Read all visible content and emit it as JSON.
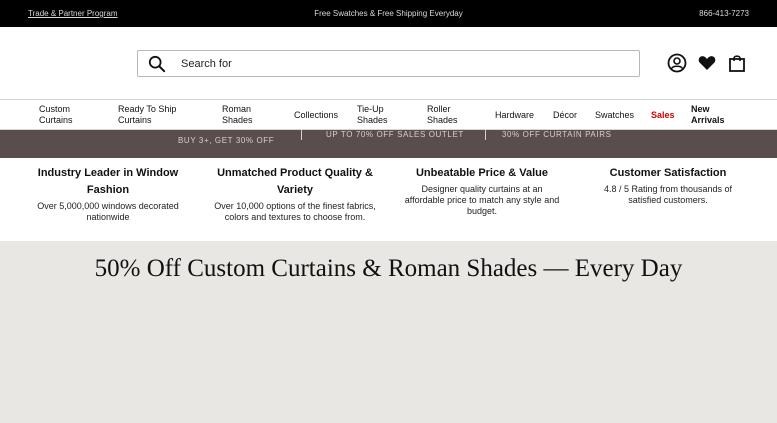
{
  "topbar": {
    "trade_link": "Trade & Partner Program",
    "announcement": "Free Swatches & Free Shipping Everyday",
    "phone": "866-413-7273"
  },
  "header": {
    "search_placeholder": "Search for",
    "icons": [
      "search-icon",
      "account-icon",
      "wishlist-heart-icon",
      "cart-bag-icon"
    ]
  },
  "nav": {
    "items": [
      "Custom Curtains",
      "Ready To Ship Curtains",
      "Roman Shades",
      "Collections",
      "Tie-Up Shades",
      "Roller Shades",
      "Hardware",
      "Décor",
      "Swatches",
      "Sales",
      "New Arrivals"
    ],
    "sales_color": "#d40000"
  },
  "promo": {
    "offer_1": "BUY 3+, GET 30% OFF",
    "offer_2": "UP TO 70% OFF SALES OUTLET",
    "offer_3": "30% OFF CURTAIN PAIRS",
    "background_color": "#5b4c4d"
  },
  "features": [
    {
      "title": "Industry Leader in Window Fashion",
      "desc": "Over 5,000,000 windows decorated nationwide"
    },
    {
      "title": "Unmatched Product Quality & Variety",
      "desc": "Over 10,000 options of the finest fabrics, colors and textures to choose from."
    },
    {
      "title": "Unbeatable Price & Value",
      "desc": "Designer quality curtains at an affordable price to match any style and budget."
    },
    {
      "title": "Customer Satisfaction",
      "desc": "4.8 / 5 Rating from thousands of satisfied customers."
    }
  ],
  "hero": {
    "title": "50% Off Custom Curtains & Roman Shades — Every Day"
  }
}
